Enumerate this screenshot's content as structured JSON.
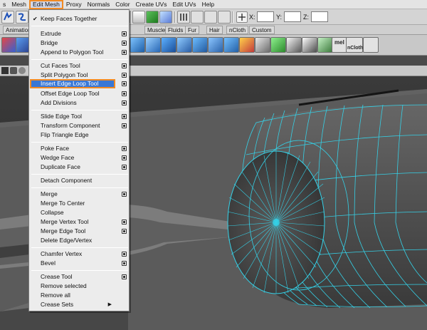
{
  "menubar": {
    "items": [
      "s",
      "Mesh",
      "Edit Mesh",
      "Proxy",
      "Normals",
      "Color",
      "Create UVs",
      "Edit UVs",
      "Help"
    ],
    "active_index": 2
  },
  "status_line": {
    "x_label": "X:",
    "y_label": "Y:",
    "z_label": "Z:",
    "x_value": "",
    "y_value": "",
    "z_value": ""
  },
  "shelf": {
    "tabs": [
      "Animation",
      "Muscle",
      "Fluids",
      "Fur",
      "Hair",
      "nCloth",
      "Custom"
    ],
    "ncloth_label": "nCloth",
    "mel_label": "mel"
  },
  "edit_mesh_menu": {
    "items": [
      {
        "label": "Keep Faces Together",
        "checked": true,
        "option": false
      },
      {
        "label": "Extrude",
        "option": true
      },
      {
        "label": "Bridge",
        "option": true
      },
      {
        "label": "Append to Polygon Tool",
        "option": true
      },
      {
        "label": "Cut Faces Tool",
        "option": true
      },
      {
        "label": "Split Polygon Tool",
        "option": true
      },
      {
        "label": "Insert Edge Loop Tool",
        "option": true,
        "highlighted": true
      },
      {
        "label": "Offset Edge Loop Tool",
        "option": true
      },
      {
        "label": "Add Divisions",
        "option": true
      },
      {
        "label": "Slide Edge Tool",
        "option": true
      },
      {
        "label": "Transform Component",
        "option": true
      },
      {
        "label": "Flip Triangle Edge",
        "option": false
      },
      {
        "label": "Poke Face",
        "option": true
      },
      {
        "label": "Wedge Face",
        "option": true
      },
      {
        "label": "Duplicate Face",
        "option": true
      },
      {
        "label": "Detach Component",
        "option": false
      },
      {
        "label": "Merge",
        "option": true
      },
      {
        "label": "Merge To Center",
        "option": false
      },
      {
        "label": "Collapse",
        "option": false
      },
      {
        "label": "Merge Vertex Tool",
        "option": true
      },
      {
        "label": "Merge Edge Tool",
        "option": true
      },
      {
        "label": "Delete Edge/Vertex",
        "option": false
      },
      {
        "label": "Chamfer Vertex",
        "option": true
      },
      {
        "label": "Bevel",
        "option": true
      },
      {
        "label": "Crease Tool",
        "option": true
      },
      {
        "label": "Remove selected",
        "option": false
      },
      {
        "label": "Remove all",
        "option": false
      },
      {
        "label": "Crease Sets",
        "option": false,
        "submenu": true
      }
    ]
  },
  "colors": {
    "highlight": "#3877d6",
    "outline_accent": "#f08a24",
    "wireframe": "#35d0e6",
    "ground": "#5b5b5b"
  }
}
